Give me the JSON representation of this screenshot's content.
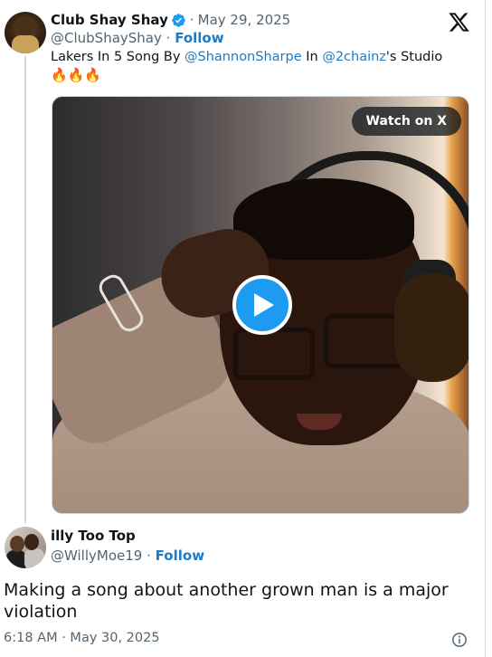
{
  "tweet": {
    "author_name": "Club Shay Shay",
    "date": "May 29, 2025",
    "handle": "@ClubShayShay",
    "follow_label": "Follow",
    "text_parts": {
      "p1": "Lakers In 5 Song By ",
      "mention1": "@ShannonSharpe",
      "p2": " In ",
      "mention2": "@2chainz",
      "p3": "'s Studio"
    },
    "emojis": "🔥🔥🔥",
    "media": {
      "watch_label": "Watch on X"
    }
  },
  "reply": {
    "author_name": "illy Too Top",
    "handle": "@WillyMoe19",
    "follow_label": "Follow",
    "text": "Making a song about another grown man is a major violation",
    "timestamp": "6:18 AM · May 30, 2025"
  },
  "icons": {
    "verified": "verified-badge-icon",
    "x_logo": "x-logo-icon",
    "play": "play-icon",
    "info": "info-icon"
  },
  "colors": {
    "link": "#1d7bc4",
    "verified": "#1d9bf0",
    "secondary_text": "#536471"
  }
}
